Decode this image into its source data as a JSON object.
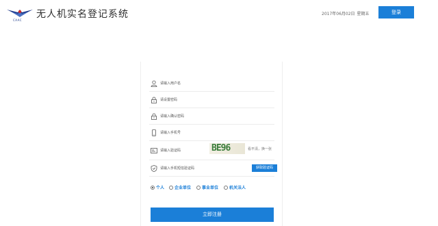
{
  "header": {
    "logo_caption": "CAAC",
    "title": "无人机实名登记系统",
    "date": "2017年06月02日",
    "weekday": "星期五",
    "login_label": "登录"
  },
  "form": {
    "username_placeholder": "请输入用户名",
    "password_placeholder": "请设置密码",
    "confirm_placeholder": "请输入确认密码",
    "phone_placeholder": "请输入手机号",
    "captcha_placeholder": "请输入验证码",
    "captcha_text": "BE96",
    "captcha_refresh": "看不清，换一张",
    "sms_placeholder": "请输入手机短信验证码",
    "sms_button": "获取验证码",
    "types": [
      {
        "label": "个人",
        "selected": true
      },
      {
        "label": "企业单位",
        "selected": false
      },
      {
        "label": "事业单位",
        "selected": false
      },
      {
        "label": "机关法人",
        "selected": false
      }
    ],
    "submit_label": "立即注册"
  },
  "colors": {
    "primary": "#1b7fd8",
    "logo_blue": "#1f3a8a",
    "logo_red": "#d22b2b"
  },
  "icons": [
    "user-icon",
    "lock-icon",
    "lock-confirm-icon",
    "phone-icon",
    "captcha-icon",
    "shield-icon"
  ]
}
